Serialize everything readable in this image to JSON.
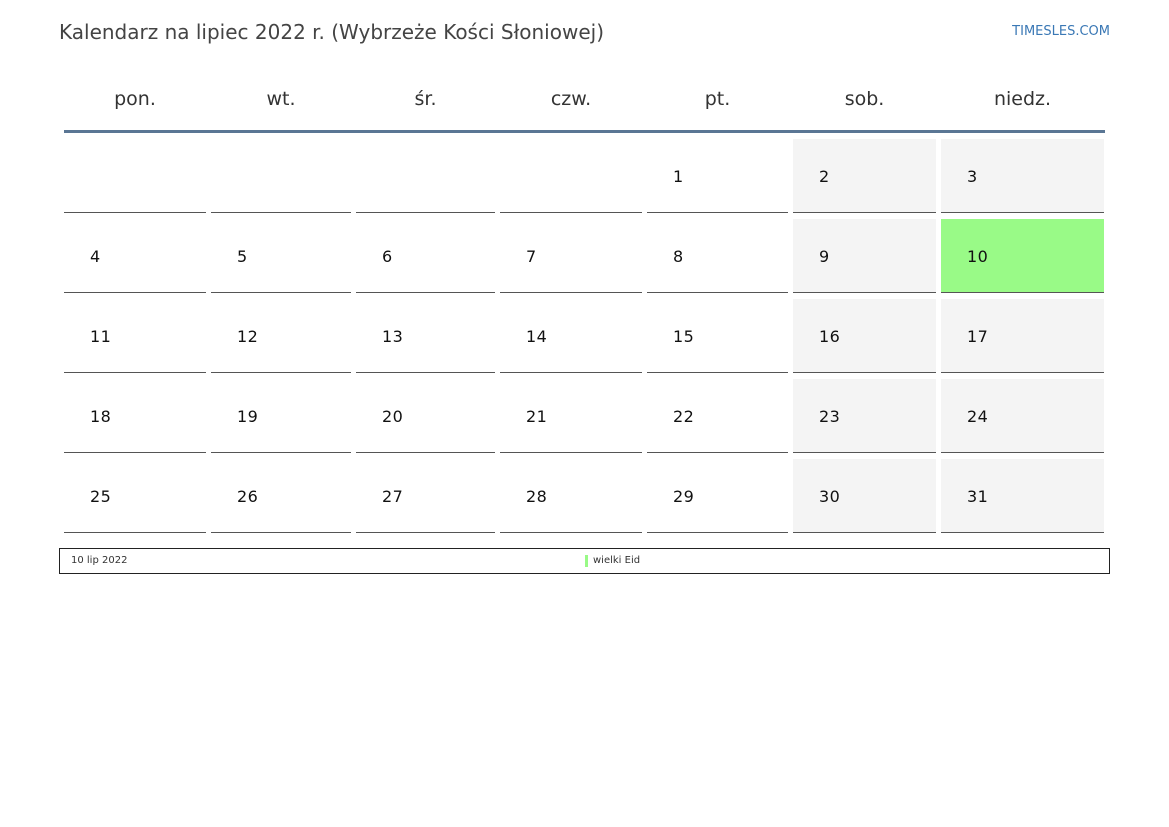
{
  "header": {
    "title": "Kalendarz na lipiec 2022 r. (Wybrzeże Kości Słoniowej)",
    "site": "TIMESLES.COM"
  },
  "weekdays": [
    "pon.",
    "wt.",
    "śr.",
    "czw.",
    "pt.",
    "sob.",
    "niedz."
  ],
  "weeks": [
    [
      "",
      "",
      "",
      "",
      "1",
      "2",
      "3"
    ],
    [
      "4",
      "5",
      "6",
      "7",
      "8",
      "9",
      "10"
    ],
    [
      "11",
      "12",
      "13",
      "14",
      "15",
      "16",
      "17"
    ],
    [
      "18",
      "19",
      "20",
      "21",
      "22",
      "23",
      "24"
    ],
    [
      "25",
      "26",
      "27",
      "28",
      "29",
      "30",
      "31"
    ]
  ],
  "holiday_day": "10",
  "legend": {
    "date": "10 lip 2022",
    "name": "wielki Eid"
  },
  "colors": {
    "holiday": "#99fa87",
    "weekend": "#f4f4f4",
    "header_line": "#5a7694",
    "site_link": "#3a78b5"
  }
}
